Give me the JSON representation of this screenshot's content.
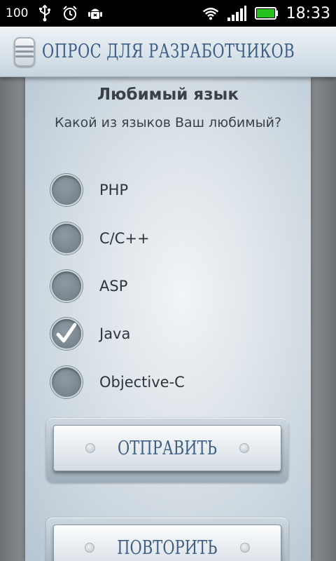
{
  "status_bar": {
    "battery_percent": "100",
    "time": "18:33"
  },
  "header": {
    "title": "ОПРОС ДЛЯ РАЗРАБОТЧИКОВ"
  },
  "question": {
    "title": "Любимый язык",
    "text": "Какой из языков Ваш любимый?",
    "options": [
      {
        "label": "PHP",
        "checked": false
      },
      {
        "label": "C/C++",
        "checked": false
      },
      {
        "label": "ASP",
        "checked": false
      },
      {
        "label": "Java",
        "checked": true
      },
      {
        "label": "Objective-C",
        "checked": false
      }
    ]
  },
  "actions": {
    "submit_label": "ОТПРАВИТЬ",
    "repeat_label": "ПОВТОРИТЬ"
  },
  "colors": {
    "accent": "#3d5f85",
    "status_bar_bg": "#000000",
    "battery_green": "#27c21c"
  }
}
